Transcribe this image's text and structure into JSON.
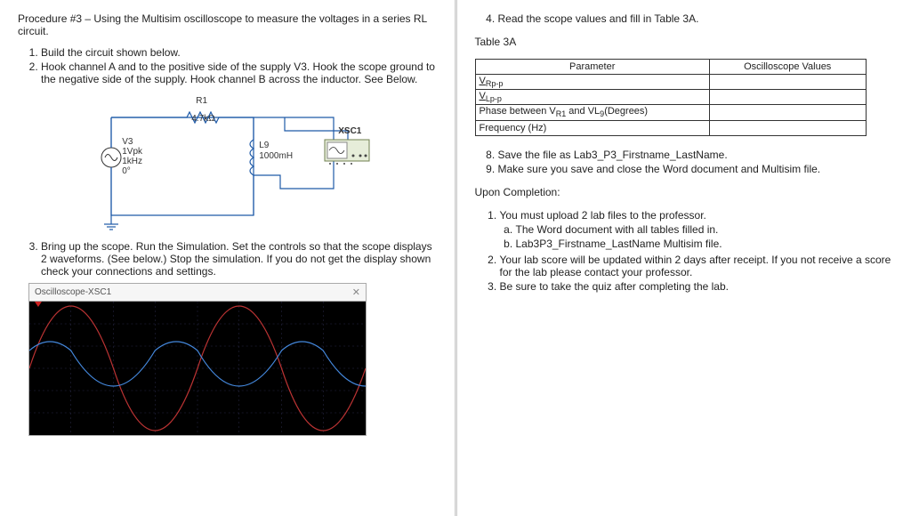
{
  "left": {
    "title": "Procedure #3 – Using the Multisim oscilloscope to measure the voltages in a series RL circuit.",
    "step1": "Build the circuit shown below.",
    "step2": "Hook channel A and to the positive side of the supply V3. Hook the scope ground to the negative side of the supply. Hook channel B across the inductor. See Below.",
    "step3": "Bring up the scope. Run the Simulation. Set the controls so that the scope displays 2 waveforms. (See below.) Stop the simulation. If you do not get the display shown check your connections and settings.",
    "circuit": {
      "r1_name": "R1",
      "r1_value": "4.7kΩ",
      "v3": "V3",
      "v3_amp": "1Vpk",
      "v3_freq": "1kHz",
      "v3_phase": "0°",
      "l9": "L9",
      "l9_value": "1000mH",
      "xsc1": "XSC1"
    },
    "scope_title": "Oscilloscope-XSC1",
    "scope_close": "✕"
  },
  "right": {
    "step4": "Read the scope values and fill in Table 3A.",
    "tableTitle": "Table 3A",
    "table": {
      "h1": "Parameter",
      "h2": "Oscilloscope Values",
      "r1": "V",
      "r1_sub": "Rp-p",
      "r2": "V",
      "r2_sub": "Lp-p",
      "r3_a": "Phase between V",
      "r3_sub1": "R1",
      "r3_b": " and VL",
      "r3_sub2": "9",
      "r3_c": "(Degrees)",
      "r4": "Frequency (Hz)"
    },
    "step8": "Save the file as Lab3_P3_Firstname_LastName.",
    "step9": "Make sure you save and close the Word document and Multisim file.",
    "uponTitle": "Upon Completion:",
    "c1": "You must upload 2 lab files to the professor.",
    "c1a": "The Word document with all tables filled in.",
    "c1b": "Lab3P3_Firstname_LastName Multisim file.",
    "c2": "Your lab score will be updated within 2 days after receipt. If you not receive a score for the lab please contact your professor.",
    "c3": "Be sure to take the quiz after completing the lab."
  }
}
